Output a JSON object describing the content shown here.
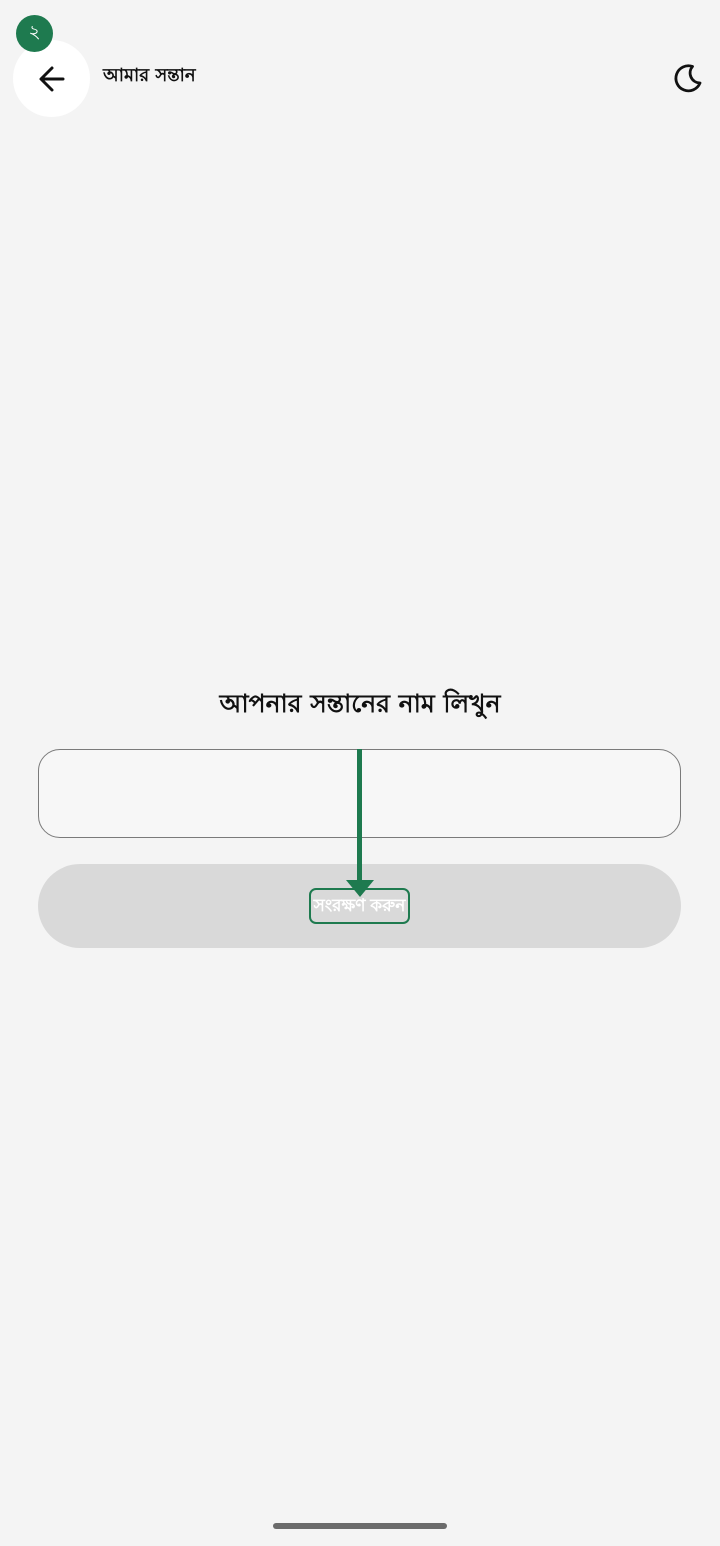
{
  "header": {
    "step_badge": "২",
    "title": "আমার সন্তান",
    "back_icon": "arrow-left-icon",
    "theme_icon": "moon-icon"
  },
  "form": {
    "prompt": "আপনার সন্তানের নাম লিখুন",
    "name_value": "",
    "name_placeholder": "",
    "save_label": "সংরক্ষণ করুন"
  },
  "colors": {
    "accent": "#1e7a4f",
    "background": "#f4f4f4",
    "button_disabled": "#d9d9d9"
  }
}
